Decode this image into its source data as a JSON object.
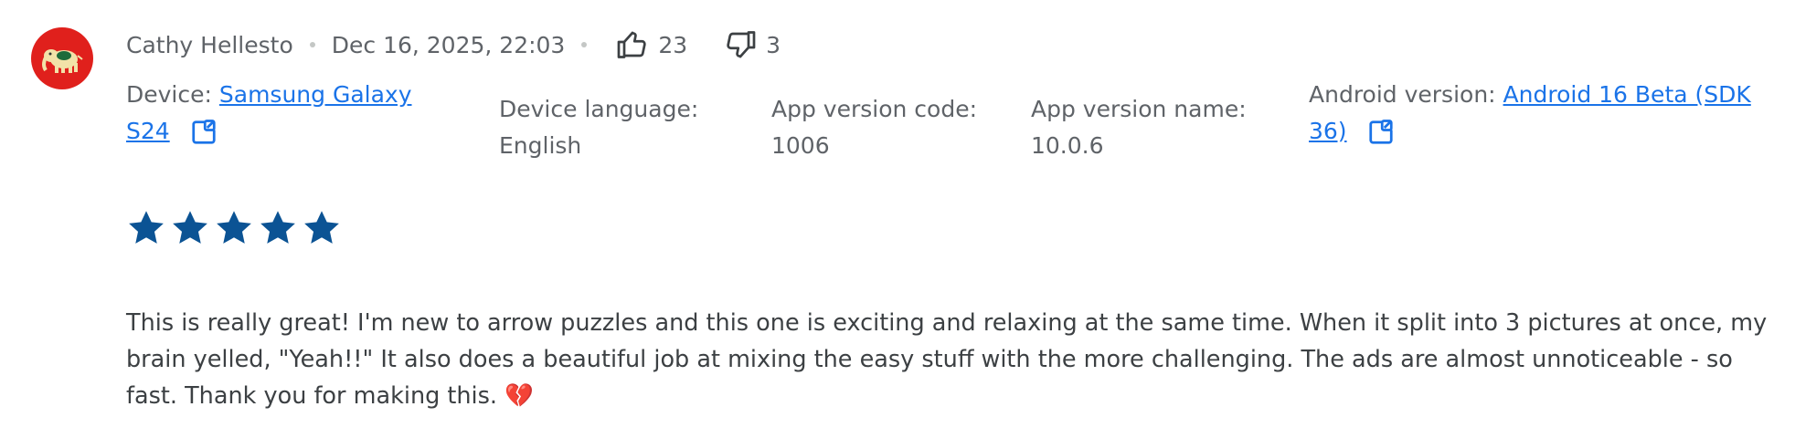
{
  "review": {
    "author": "Cathy Hellesto",
    "date": "Dec 16, 2025, 22:03",
    "thumbs_up_count": "23",
    "thumbs_down_count": "3",
    "rating": 5,
    "text": "This is really great! I'm new to arrow puzzles and this one is exciting and relaxing at the same time. When it split into 3 pictures at once, my brain yelled, \"Yeah!!\" It also does a beautiful job at mixing the easy stuff with the more challenging. The ads are almost unnoticeable - so fast. Thank you for making this. 💔"
  },
  "device_info": {
    "device_label": "Device:",
    "device_link_line1": "Samsung Galaxy",
    "device_link_line2": "S24",
    "language_label": "Device language:",
    "language_value": "English",
    "version_code_label": "App version code:",
    "version_code_value": "1006",
    "version_name_label": "App version name:",
    "version_name_value": "10.0.6",
    "android_label": "Android version:",
    "android_link_line1": "Android 16 Beta (SDK",
    "android_link_line2": "36)"
  },
  "icons": {
    "avatar": "elephant-avatar-icon",
    "thumbs_up": "thumbs-up-icon",
    "thumbs_down": "thumbs-down-icon",
    "open_link": "open-in-new-icon",
    "star": "star-icon"
  },
  "colors": {
    "star": "#0b5394",
    "link": "#1a73e8",
    "avatar_bg": "#e0201c",
    "text": "#3c4043",
    "muted": "#5f6368"
  }
}
